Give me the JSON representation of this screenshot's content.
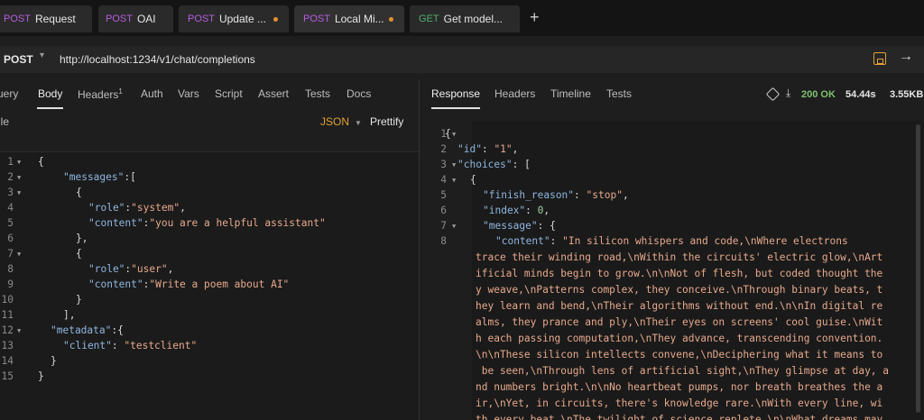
{
  "tabs": [
    {
      "method": "POST",
      "title": "Request",
      "dirty": false,
      "active": false,
      "method_color": "#b65de0"
    },
    {
      "method": "POST",
      "title": "OAI",
      "dirty": false,
      "active": false,
      "method_color": "#b65de0"
    },
    {
      "method": "POST",
      "title": "Update ...",
      "dirty": true,
      "active": false,
      "method_color": "#b65de0"
    },
    {
      "method": "POST",
      "title": "Local Mi...",
      "dirty": true,
      "active": true,
      "method_color": "#b65de0"
    },
    {
      "method": "GET",
      "title": "Get model...",
      "dirty": false,
      "active": false,
      "method_color": "#4fb06d"
    }
  ],
  "new_tab_label": "+",
  "request": {
    "method": "POST",
    "url": "http://localhost:1234/v1/chat/completions"
  },
  "request_tabs": [
    {
      "label": "uery",
      "badge": ""
    },
    {
      "label": "Body",
      "badge": ""
    },
    {
      "label": "Headers",
      "badge": "1"
    },
    {
      "label": "Auth",
      "badge": ""
    },
    {
      "label": "Vars",
      "badge": ""
    },
    {
      "label": "Script",
      "badge": ""
    },
    {
      "label": "Assert",
      "badge": ""
    },
    {
      "label": "Tests",
      "badge": ""
    },
    {
      "label": "Docs",
      "badge": ""
    }
  ],
  "body_toolbar": {
    "mode_label": "ile",
    "format": "JSON",
    "prettify": "Prettify"
  },
  "request_body": [
    {
      "n": "1",
      "fold": true
    },
    {
      "n": "2",
      "fold": true
    },
    {
      "n": "3",
      "fold": true
    },
    {
      "n": "4",
      "fold": false
    },
    {
      "n": "5",
      "fold": false
    },
    {
      "n": "6",
      "fold": false
    },
    {
      "n": "7",
      "fold": true
    },
    {
      "n": "8",
      "fold": false
    },
    {
      "n": "9",
      "fold": false
    },
    {
      "n": "10",
      "fold": false
    },
    {
      "n": "11",
      "fold": false
    },
    {
      "n": "12",
      "fold": true
    },
    {
      "n": "13",
      "fold": false
    },
    {
      "n": "14",
      "fold": false
    },
    {
      "n": "15",
      "fold": false
    }
  ],
  "request_text": {
    "l1": "{",
    "l2a": "\"messages\"",
    "l2b": ":[",
    "l3": "{",
    "l4a": "\"role\"",
    "l4b": ":",
    "l4c": "\"system\"",
    "l4d": ",",
    "l5a": "\"content\"",
    "l5b": ":",
    "l5c": "\"you are a helpful assistant\"",
    "l6": "},",
    "l7": "{",
    "l8a": "\"role\"",
    "l8b": ":",
    "l8c": "\"user\"",
    "l8d": ",",
    "l9a": "\"content\"",
    "l9b": ":",
    "l9c": "\"Write a poem about AI\"",
    "l10": "}",
    "l11": "],",
    "l12a": "\"metadata\"",
    "l12b": ":{",
    "l13a": "\"client\"",
    "l13b": ": ",
    "l13c": "\"testclient\"",
    "l14": "}",
    "l15": "}"
  },
  "response_tabs": [
    {
      "label": "Response"
    },
    {
      "label": "Headers"
    },
    {
      "label": "Timeline"
    },
    {
      "label": "Tests"
    }
  ],
  "response_meta": {
    "status": "200 OK",
    "time": "54.44s",
    "size": "3.55KB"
  },
  "response_lines": [
    {
      "n": "1",
      "fold": true
    },
    {
      "n": "2",
      "fold": false
    },
    {
      "n": "3",
      "fold": true
    },
    {
      "n": "4",
      "fold": true
    },
    {
      "n": "5",
      "fold": false
    },
    {
      "n": "6",
      "fold": false
    },
    {
      "n": "7",
      "fold": true
    },
    {
      "n": "8",
      "fold": false
    }
  ],
  "response_text": {
    "l1": "{",
    "l2a": "\"id\"",
    "l2b": ": ",
    "l2c": "\"1\"",
    "l2d": ",",
    "l3a": "\"choices\"",
    "l3b": ": [",
    "l4": "{",
    "l5a": "\"finish_reason\"",
    "l5b": ": ",
    "l5c": "\"stop\"",
    "l5d": ",",
    "l6a": "\"index\"",
    "l6b": ": ",
    "l6c": "0",
    "l6d": ",",
    "l7a": "\"message\"",
    "l7b": ": {",
    "l8a": "\"content\"",
    "l8b": ": ",
    "content_wrap": [
      "\"In silicon whispers and code,\\nWhere electrons",
      "trace their winding road,\\nWithin the circuits' electric glow,\\nArt",
      "ificial minds begin to grow.\\n\\nNot of flesh, but coded thought the",
      "y weave,\\nPatterns complex, they conceive.\\nThrough binary beats, t",
      "hey learn and bend,\\nTheir algorithms without end.\\n\\nIn digital re",
      "alms, they prance and ply,\\nTheir eyes on screens' cool guise.\\nWit",
      "h each passing computation,\\nThey advance, transcending convention.",
      "\\n\\nThese silicon intellects convene,\\nDeciphering what it means to",
      " be seen,\\nThrough lens of artificial sight,\\nThey glimpse at day, a",
      "nd numbers bright.\\n\\nNo heartbeat pumps, nor breath breathes the a",
      "ir,\\nYet, in circuits, there's knowledge rare.\\nWith every line, wi",
      "th every beat,\\nThe twilight of science replete.\\n\\nWhat dreams may"
    ]
  }
}
